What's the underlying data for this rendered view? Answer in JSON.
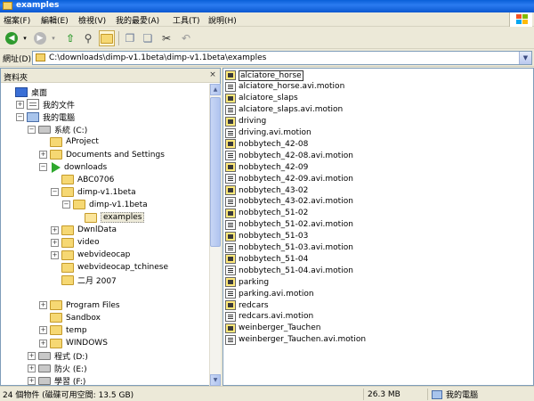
{
  "window": {
    "title": "examples"
  },
  "menu": [
    {
      "label": "檔案(F)"
    },
    {
      "label": "編輯(E)"
    },
    {
      "label": "檢視(V)"
    },
    {
      "label": "我的最愛(A)"
    },
    {
      "label": "工具(T)"
    },
    {
      "label": "說明(H)"
    }
  ],
  "toolbar": {
    "back_icon": "back-arrow-icon",
    "forward_icon": "forward-arrow-icon",
    "up_icon": "up-folder-icon",
    "search_icon": "search-icon",
    "folders_icon": "folders-icon",
    "copy_icon": "copy-to-icon",
    "move_icon": "move-to-icon",
    "cut_icon": "cut-icon",
    "undo_icon": "undo-icon"
  },
  "address": {
    "label": "網址(D)",
    "value": "C:\\downloads\\dimp-v1.1beta\\dimp-v1.1beta\\examples"
  },
  "folder_pane": {
    "title": "資料夾",
    "close_glyph": "×",
    "tree": [
      {
        "label": "桌面",
        "level": 0,
        "toggle": "",
        "icon": "desktop"
      },
      {
        "label": "我的文件",
        "level": 1,
        "toggle": "+",
        "icon": "document"
      },
      {
        "label": "我的電腦",
        "level": 1,
        "toggle": "−",
        "icon": "computer"
      },
      {
        "label": "系統 (C:)",
        "level": 2,
        "toggle": "−",
        "icon": "drive"
      },
      {
        "label": "AProject",
        "level": 3,
        "toggle": "",
        "icon": "folder"
      },
      {
        "label": "Documents and Settings",
        "level": 3,
        "toggle": "+",
        "icon": "folder"
      },
      {
        "label": "downloads",
        "level": 3,
        "toggle": "−",
        "icon": "arrow"
      },
      {
        "label": "ABC0706",
        "level": 4,
        "toggle": "",
        "icon": "folder"
      },
      {
        "label": "dimp-v1.1beta",
        "level": 4,
        "toggle": "−",
        "icon": "folder"
      },
      {
        "label": "dimp-v1.1beta",
        "level": 5,
        "toggle": "−",
        "icon": "folder"
      },
      {
        "label": "examples",
        "level": 6,
        "toggle": "",
        "icon": "folder-open",
        "selected": true
      },
      {
        "label": "DwnlData",
        "level": 4,
        "toggle": "+",
        "icon": "folder"
      },
      {
        "label": "video",
        "level": 4,
        "toggle": "+",
        "icon": "folder"
      },
      {
        "label": "webvideocap",
        "level": 4,
        "toggle": "+",
        "icon": "folder"
      },
      {
        "label": "webvideocap_tchinese",
        "level": 4,
        "toggle": "",
        "icon": "folder"
      },
      {
        "label": "二月 2007",
        "level": 4,
        "toggle": "",
        "icon": "folder"
      },
      {
        "label": "",
        "level": 4,
        "toggle": "",
        "icon": "none"
      },
      {
        "label": "Program Files",
        "level": 3,
        "toggle": "+",
        "icon": "folder"
      },
      {
        "label": "Sandbox",
        "level": 3,
        "toggle": "",
        "icon": "folder"
      },
      {
        "label": "temp",
        "level": 3,
        "toggle": "+",
        "icon": "folder"
      },
      {
        "label": "WINDOWS",
        "level": 3,
        "toggle": "+",
        "icon": "folder"
      },
      {
        "label": "程式 (D:)",
        "level": 2,
        "toggle": "+",
        "icon": "drive"
      },
      {
        "label": "防火 (E:)",
        "level": 2,
        "toggle": "+",
        "icon": "drive"
      },
      {
        "label": "學習 (F:)",
        "level": 2,
        "toggle": "+",
        "icon": "drive"
      }
    ],
    "scroll_up": "▲",
    "scroll_down": "▼"
  },
  "files": [
    {
      "name": "alciatore_horse",
      "type": "clip",
      "selected": true
    },
    {
      "name": "alciatore_horse.avi.motion",
      "type": "motion"
    },
    {
      "name": "alciatore_slaps",
      "type": "clip"
    },
    {
      "name": "alciatore_slaps.avi.motion",
      "type": "motion"
    },
    {
      "name": "driving",
      "type": "clip"
    },
    {
      "name": "driving.avi.motion",
      "type": "motion"
    },
    {
      "name": "nobbytech_42-08",
      "type": "clip"
    },
    {
      "name": "nobbytech_42-08.avi.motion",
      "type": "motion"
    },
    {
      "name": "nobbytech_42-09",
      "type": "clip"
    },
    {
      "name": "nobbytech_42-09.avi.motion",
      "type": "motion"
    },
    {
      "name": "nobbytech_43-02",
      "type": "clip"
    },
    {
      "name": "nobbytech_43-02.avi.motion",
      "type": "motion"
    },
    {
      "name": "nobbytech_51-02",
      "type": "clip"
    },
    {
      "name": "nobbytech_51-02.avi.motion",
      "type": "motion"
    },
    {
      "name": "nobbytech_51-03",
      "type": "clip"
    },
    {
      "name": "nobbytech_51-03.avi.motion",
      "type": "motion"
    },
    {
      "name": "nobbytech_51-04",
      "type": "clip"
    },
    {
      "name": "nobbytech_51-04.avi.motion",
      "type": "motion"
    },
    {
      "name": "parking",
      "type": "clip"
    },
    {
      "name": "parking.avi.motion",
      "type": "motion"
    },
    {
      "name": "redcars",
      "type": "clip"
    },
    {
      "name": "redcars.avi.motion",
      "type": "motion"
    },
    {
      "name": "weinberger_Tauchen",
      "type": "clip"
    },
    {
      "name": "weinberger_Tauchen.avi.motion",
      "type": "motion"
    }
  ],
  "status": {
    "count": "24 個物件 (磁碟可用空間: 13.5 GB)",
    "size": "26.3 MB",
    "location": "我的電腦"
  },
  "colors": {
    "titlebar": "#0a5fd8",
    "chrome": "#ece9d8",
    "border": "#7f9db9"
  }
}
